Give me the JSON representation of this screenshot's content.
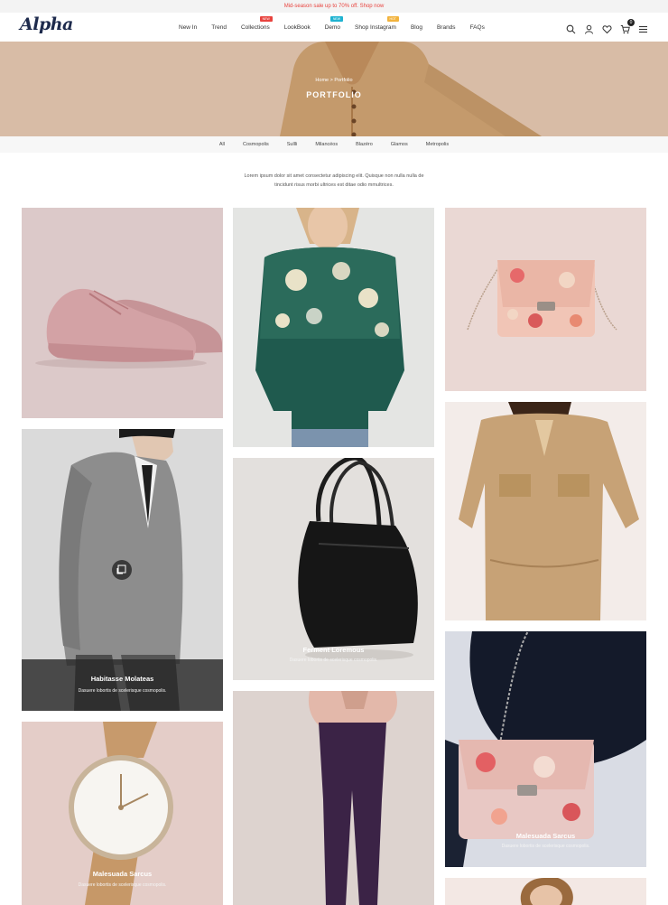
{
  "topbar": {
    "promo": "Mid-season sale up to 70% off. Shop now"
  },
  "header": {
    "logo": "Alpha",
    "nav": [
      {
        "label": "New In"
      },
      {
        "label": "Trend"
      },
      {
        "label": "Collections",
        "badge": "NEW",
        "badge_color": "#e8433e"
      },
      {
        "label": "LookBook"
      },
      {
        "label": "Demo",
        "badge": "NEW",
        "badge_color": "#1fb3d1"
      },
      {
        "label": "Shop Instagram",
        "badge": "HOT",
        "badge_color": "#f2b33d"
      },
      {
        "label": "Blog"
      },
      {
        "label": "Brands"
      },
      {
        "label": "FAQs"
      }
    ],
    "cart_count": "0",
    "icons": [
      "search-icon",
      "account-icon",
      "heart-icon",
      "cart-icon",
      "menu-icon"
    ]
  },
  "hero": {
    "breadcrumb_home": "Home",
    "breadcrumb_sep": ">",
    "breadcrumb_current": "Portfolio",
    "title": "PORTFOLIO"
  },
  "filters": [
    "All",
    "Cosmopolis",
    "Sullli",
    "Milancéos",
    "Blazéro",
    "Glamos",
    "Metropolis"
  ],
  "intro": "Lorem ipsum dolor sit amet consectetur adipiscing elit. Quisque non nulla nulla de tincidunt risus morbi ultrices est ditae odio mmultrices.",
  "cards": {
    "card2": {
      "title": "Habitasse Molateas",
      "subtitle": "Dasuere lobortis de scelerisque cosmopolis."
    },
    "card5": {
      "title": "Ferment Loremous",
      "subtitle": "Dasuere lobortis de scelerisque cosmopolis."
    },
    "card3": {
      "title": "Malesuada Sarcus",
      "subtitle": "Dasuere lobortis de scelerisque cosmopolis."
    },
    "card8": {
      "title": "Malesuada Sarcus",
      "subtitle": "Dasuere lobortis de scelerisque cosmopolis."
    }
  }
}
